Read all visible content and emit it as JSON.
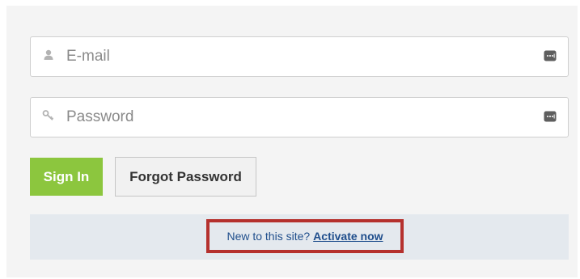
{
  "form": {
    "email": {
      "placeholder": "E-mail",
      "value": "",
      "icon": "user-icon"
    },
    "password": {
      "placeholder": "Password",
      "value": "",
      "icon": "key-icon"
    },
    "autofill_icon": "password-manager-icon",
    "sign_in_label": "Sign In",
    "forgot_label": "Forgot Password"
  },
  "activate": {
    "prompt": "New to this site?",
    "link_label": "Activate now"
  },
  "colors": {
    "sign_in_bg": "#8cc63e",
    "highlight_border": "#b5312e",
    "link": "#1f4e8c",
    "activate_bar_bg": "#e4e9ee"
  }
}
